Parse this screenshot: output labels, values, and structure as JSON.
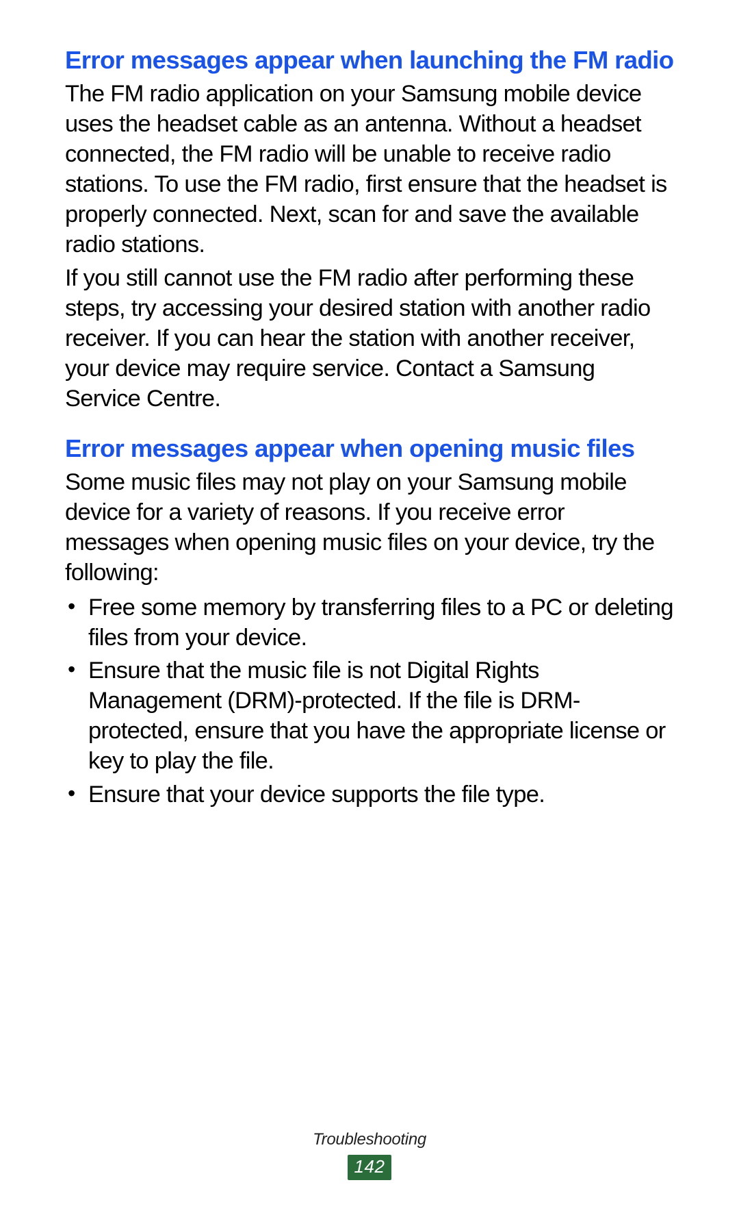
{
  "sections": [
    {
      "heading": "Error messages appear when launching the FM radio",
      "paragraphs": [
        "The FM radio application on your Samsung mobile device uses the headset cable as an antenna. Without a headset connected, the FM radio will be unable to receive radio stations. To use the FM radio, first ensure that the headset is properly connected. Next, scan for and save the available radio stations.",
        "If you still cannot use the FM radio after performing these steps, try accessing your desired station with another radio receiver. If you can hear the station with another receiver, your device may require service. Contact a Samsung Service Centre."
      ]
    },
    {
      "heading": "Error messages appear when opening music files",
      "paragraphs": [
        "Some music files may not play on your Samsung mobile device for a variety of reasons. If you receive error messages when opening music files on your device, try the following:"
      ],
      "bullets": [
        "Free some memory by transferring files to a PC or deleting files from your device.",
        "Ensure that the music file is not Digital Rights Management (DRM)-protected. If the file is DRM-protected, ensure that you have the appropriate license or key to play the file.",
        "Ensure that your device supports the file type."
      ]
    }
  ],
  "footer": {
    "section_label": "Troubleshooting",
    "page_number": "142"
  }
}
